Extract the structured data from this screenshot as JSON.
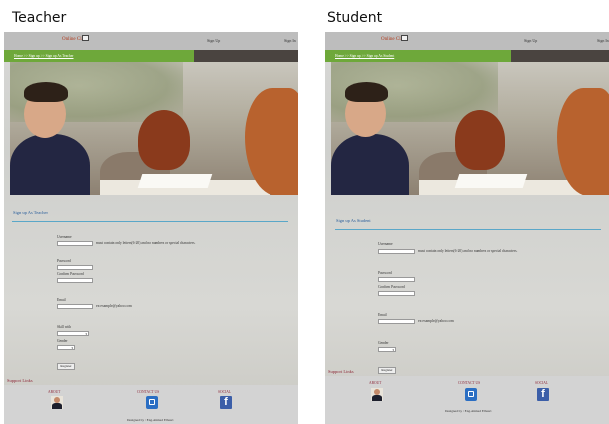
{
  "captions": {
    "teacher": "Teacher",
    "student": "Student"
  },
  "site": {
    "brand": "Online Class",
    "nav": {
      "signup": "Sign Up",
      "signin": "Sign In"
    }
  },
  "teacher": {
    "breadcrumb": "Home >> Sign up >> Sign up As Teacher",
    "heading": "Sign up As Teacher",
    "form": {
      "username_label": "Username",
      "username_value": "",
      "username_hint": "must contain only letters(6-20) and no numbers or special characters.",
      "password_label": "Password",
      "password_value": "",
      "confirm_label": "Confirm Password",
      "confirm_value": "",
      "email_label": "Email",
      "email_value": "",
      "email_hint": "ex:example@yahoo.com",
      "skill_label": "Skill with",
      "skill_value": "",
      "gender_label": "Gender",
      "gender_value": "",
      "register_label": "Register"
    }
  },
  "student": {
    "breadcrumb": "Home >> Sign up >> Sign up As Student",
    "heading": "Sign up As Student",
    "form": {
      "username_label": "Username",
      "username_value": "",
      "username_hint": "must contain only letters(6-20) and no numbers or special characters.",
      "password_label": "Password",
      "password_value": "",
      "confirm_label": "Confirm Password",
      "confirm_value": "",
      "email_label": "Email",
      "email_value": "",
      "email_hint": "ex:example@yahoo.com",
      "gender_label": "Gender",
      "gender_value": "",
      "register_label": "Register"
    }
  },
  "footer": {
    "support_links": "Support Links",
    "about": "ABOUT",
    "contact": "CONTACT US",
    "social": "SOCIAL",
    "designed_by": "Designed by : Eng.Ahmed Elbasri"
  },
  "colors": {
    "topbar": "#bdbdbd",
    "green_bar": "#6ea83a",
    "dark_bar": "#4a4440",
    "heading_blue": "#2b5f9b",
    "rule_blue": "#5aa7c8",
    "footer_maroon": "#8e2a3a",
    "brand_red": "#b13b1e"
  },
  "icons": {
    "about": "person-icon",
    "contact": "contact-icon",
    "social": "facebook-icon"
  }
}
